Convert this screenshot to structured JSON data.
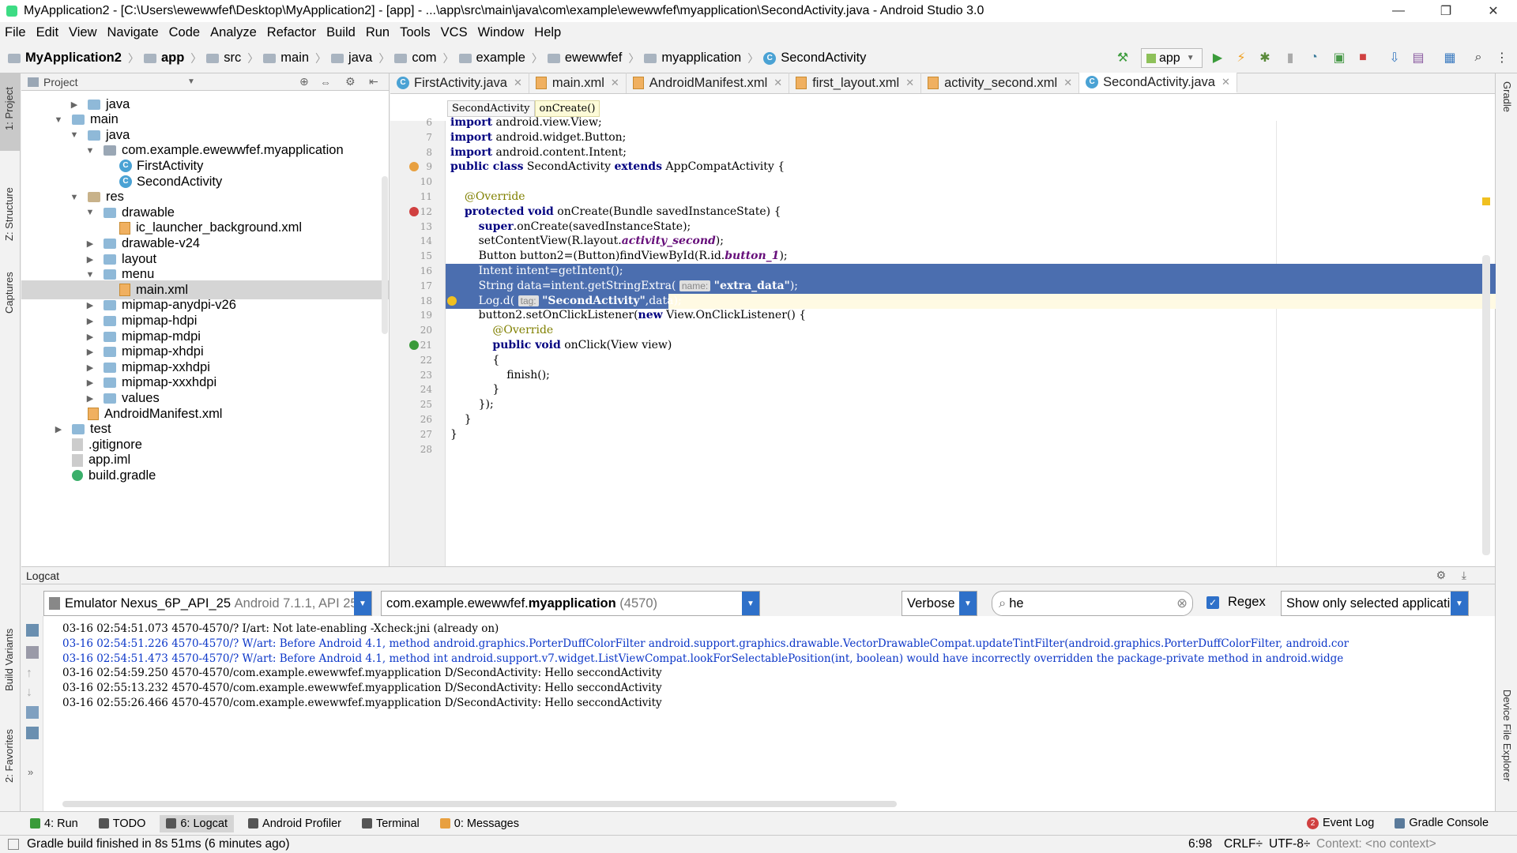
{
  "window": {
    "title": "MyApplication2 - [C:\\Users\\ewewwfef\\Desktop\\MyApplication2] - [app] - ...\\app\\src\\main\\java\\com\\example\\ewewwfef\\myapplication\\SecondActivity.java - Android Studio 3.0",
    "minimize": "—",
    "restore": "❐",
    "close": "✕"
  },
  "menu": [
    "File",
    "Edit",
    "View",
    "Navigate",
    "Code",
    "Analyze",
    "Refactor",
    "Build",
    "Run",
    "Tools",
    "VCS",
    "Window",
    "Help"
  ],
  "breadcrumbs": [
    "MyApplication2",
    "app",
    "src",
    "main",
    "java",
    "com",
    "example",
    "ewewwfef",
    "myapplication",
    "SecondActivity"
  ],
  "toolbar": {
    "run_config": "app"
  },
  "left_tools": {
    "project": "1: Project",
    "structure": "Z: Structure",
    "captures": "Captures",
    "build_variants": "Build Variants",
    "favorites": "2: Favorites"
  },
  "right_tools": {
    "gradle": "Gradle",
    "device_explorer": "Device File Explorer"
  },
  "project_panel": {
    "title": "Project",
    "tree": [
      {
        "label": "java",
        "depth": 4,
        "arrow": "▶",
        "icon": "folder"
      },
      {
        "label": "main",
        "depth": 3,
        "arrow": "▼",
        "icon": "folder"
      },
      {
        "label": "java",
        "depth": 4,
        "arrow": "▼",
        "icon": "folder"
      },
      {
        "label": "com.example.ewewwfef.myapplication",
        "depth": 5,
        "arrow": "▼",
        "icon": "package"
      },
      {
        "label": "FirstActivity",
        "depth": 6,
        "arrow": "",
        "icon": "class"
      },
      {
        "label": "SecondActivity",
        "depth": 6,
        "arrow": "",
        "icon": "class"
      },
      {
        "label": "res",
        "depth": 4,
        "arrow": "▼",
        "icon": "res"
      },
      {
        "label": "drawable",
        "depth": 5,
        "arrow": "▼",
        "icon": "folder"
      },
      {
        "label": "ic_launcher_background.xml",
        "depth": 6,
        "arrow": "",
        "icon": "xml"
      },
      {
        "label": "drawable-v24",
        "depth": 5,
        "arrow": "▶",
        "icon": "folder"
      },
      {
        "label": "layout",
        "depth": 5,
        "arrow": "▶",
        "icon": "folder"
      },
      {
        "label": "menu",
        "depth": 5,
        "arrow": "▼",
        "icon": "folder"
      },
      {
        "label": "main.xml",
        "depth": 6,
        "arrow": "",
        "icon": "xml",
        "selected": true
      },
      {
        "label": "mipmap-anydpi-v26",
        "depth": 5,
        "arrow": "▶",
        "icon": "folder"
      },
      {
        "label": "mipmap-hdpi",
        "depth": 5,
        "arrow": "▶",
        "icon": "folder"
      },
      {
        "label": "mipmap-mdpi",
        "depth": 5,
        "arrow": "▶",
        "icon": "folder"
      },
      {
        "label": "mipmap-xhdpi",
        "depth": 5,
        "arrow": "▶",
        "icon": "folder"
      },
      {
        "label": "mipmap-xxhdpi",
        "depth": 5,
        "arrow": "▶",
        "icon": "folder"
      },
      {
        "label": "mipmap-xxxhdpi",
        "depth": 5,
        "arrow": "▶",
        "icon": "folder"
      },
      {
        "label": "values",
        "depth": 5,
        "arrow": "▶",
        "icon": "folder"
      },
      {
        "label": "AndroidManifest.xml",
        "depth": 4,
        "arrow": "",
        "icon": "manifest"
      },
      {
        "label": "test",
        "depth": 3,
        "arrow": "▶",
        "icon": "folder"
      },
      {
        "label": ".gitignore",
        "depth": 3,
        "arrow": "",
        "icon": "file"
      },
      {
        "label": "app.iml",
        "depth": 3,
        "arrow": "",
        "icon": "file"
      },
      {
        "label": "build.gradle",
        "depth": 3,
        "arrow": "",
        "icon": "gradle"
      }
    ]
  },
  "editor_tabs": [
    {
      "label": "FirstActivity.java",
      "icon": "class"
    },
    {
      "label": "main.xml",
      "icon": "xml"
    },
    {
      "label": "AndroidManifest.xml",
      "icon": "manifest"
    },
    {
      "label": "first_layout.xml",
      "icon": "xml"
    },
    {
      "label": "activity_second.xml",
      "icon": "xml"
    },
    {
      "label": "SecondActivity.java",
      "icon": "class",
      "active": true
    }
  ],
  "editor_breadcrumb": [
    "SecondActivity",
    "onCreate()"
  ],
  "code_lines": [
    {
      "n": "6",
      "html": "<span class=\"kw\">import</span> android.view.View;"
    },
    {
      "n": "7",
      "html": "<span class=\"kw\">import</span> android.widget.Button;"
    },
    {
      "n": "8",
      "html": "<span class=\"kw\">import</span> android.content.Intent;"
    },
    {
      "n": "9",
      "html": "<span class=\"kw\">public class</span> SecondActivity <span class=\"kw\">extends</span> AppCompatActivity {"
    },
    {
      "n": "10",
      "html": ""
    },
    {
      "n": "11",
      "html": "    <span class=\"an\">@Override</span>"
    },
    {
      "n": "12",
      "html": "    <span class=\"kw\">protected void</span> onCreate(Bundle savedInstanceState) {"
    },
    {
      "n": "13",
      "html": "        <span class=\"kw\">super</span>.onCreate(savedInstanceState);"
    },
    {
      "n": "14",
      "html": "        setContentView(R.layout.<span class=\"it\">activity_second</span>);"
    },
    {
      "n": "15",
      "html": "        Button button2=(Button)findViewById(R.id.<span class=\"it\">button_1</span>);"
    },
    {
      "n": "16",
      "html": "        Intent intent=getIntent();",
      "selected": true
    },
    {
      "n": "17",
      "html": "        String data=intent.getStringExtra( <span class=\"hint\">name:</span> <span class=\"st\" style=\"color:#fff\">\"extra_data\"</span>);",
      "selected": true
    },
    {
      "n": "18",
      "html": "        Log.d( <span class=\"hint\">tag:</span> <span class=\"st\" style=\"color:#fff\">\"SecondActivity\"</span>,data);",
      "selected_part": true
    },
    {
      "n": "19",
      "html": "        button2.setOnClickListener(<span class=\"kw\">new</span> View.OnClickListener() {"
    },
    {
      "n": "20",
      "html": "            <span class=\"an\">@Override</span>"
    },
    {
      "n": "21",
      "html": "            <span class=\"kw\">public void</span> onClick(View view)"
    },
    {
      "n": "22",
      "html": "            {"
    },
    {
      "n": "23",
      "html": "                finish();"
    },
    {
      "n": "24",
      "html": "            }"
    },
    {
      "n": "25",
      "html": "        });"
    },
    {
      "n": "26",
      "html": "    }"
    },
    {
      "n": "27",
      "html": "}"
    },
    {
      "n": "28",
      "html": ""
    }
  ],
  "logcat": {
    "title": "Logcat",
    "device": "Emulator Nexus_6P_API_25",
    "device_detail": "Android 7.1.1, API 25",
    "process_prefix": "com.example.ewewwfef.",
    "process_bold": "myapplication",
    "process_pid": "(4570)",
    "level": "Verbose",
    "search_value": "he",
    "regex_label": "Regex",
    "filter": "Show only selected application",
    "lines": [
      {
        "text": "03-16 02:54:51.073 4570-4570/? I/art: Not late-enabling -Xcheck:jni (already on)",
        "level": "i"
      },
      {
        "text": "03-16 02:54:51.226 4570-4570/? W/art: Before Android 4.1, method android.graphics.PorterDuffColorFilter android.support.graphics.drawable.VectorDrawableCompat.updateTintFilter(android.graphics.PorterDuffColorFilter, android.cor",
        "level": "w"
      },
      {
        "text": "03-16 02:54:51.473 4570-4570/? W/art: Before Android 4.1, method int android.support.v7.widget.ListViewCompat.lookForSelectablePosition(int, boolean) would have incorrectly overridden the package-private method in android.widge",
        "level": "w"
      },
      {
        "text": "03-16 02:54:59.250 4570-4570/com.example.ewewwfef.myapplication D/SecondActivity: Hello seccondActivity",
        "level": "d"
      },
      {
        "text": "03-16 02:55:13.232 4570-4570/com.example.ewewwfef.myapplication D/SecondActivity: Hello seccondActivity",
        "level": "d"
      },
      {
        "text": "03-16 02:55:26.466 4570-4570/com.example.ewewwfef.myapplication D/SecondActivity: Hello seccondActivity",
        "level": "d"
      }
    ]
  },
  "bottom_tools": [
    {
      "label": "4: Run",
      "icon": "run"
    },
    {
      "label": "TODO",
      "icon": "todo"
    },
    {
      "label": "6: Logcat",
      "icon": "logcat",
      "active": true
    },
    {
      "label": "Android Profiler",
      "icon": "profiler"
    },
    {
      "label": "Terminal",
      "icon": "terminal"
    },
    {
      "label": "0: Messages",
      "icon": "messages"
    }
  ],
  "bottom_right_tools": [
    {
      "label": "Event Log",
      "badge": "2"
    },
    {
      "label": "Gradle Console"
    }
  ],
  "status": {
    "message": "Gradle build finished in 8s 51ms (6 minutes ago)",
    "position": "6:98",
    "line_sep": "CRLF÷",
    "encoding": "UTF-8÷",
    "context": "Context: <no context>"
  }
}
